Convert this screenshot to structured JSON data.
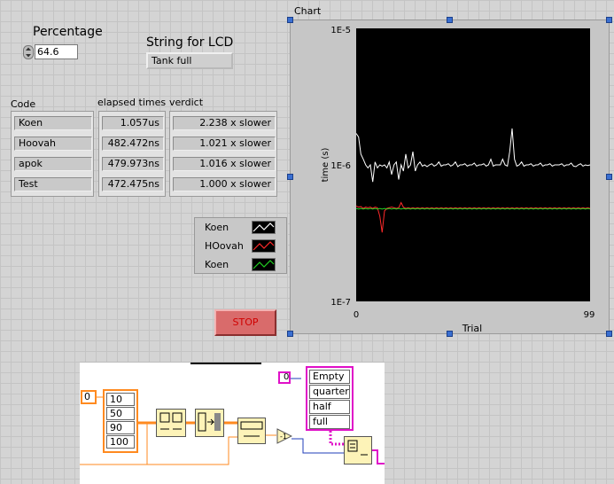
{
  "percentage": {
    "label": "Percentage",
    "value": "64.6"
  },
  "lcd": {
    "label": "String for LCD",
    "value": "Tank full"
  },
  "table": {
    "headers": {
      "code": "Code",
      "elapsed": "elapsed times",
      "verdict": "verdict"
    },
    "rows": [
      {
        "code": "Koen",
        "elapsed": "1.057us",
        "verdict": "2.238 x slower"
      },
      {
        "code": "Hoovah",
        "elapsed": "482.472ns",
        "verdict": "1.021 x slower"
      },
      {
        "code": "apok",
        "elapsed": "479.973ns",
        "verdict": "1.016 x slower"
      },
      {
        "code": "Test",
        "elapsed": "472.475ns",
        "verdict": "1.000 x slower"
      }
    ]
  },
  "legend": [
    {
      "name": "Koen",
      "color": "#ffffff"
    },
    {
      "name": "HOovah",
      "color": "#ff2a2a"
    },
    {
      "name": "Koen",
      "color": "#22d022"
    }
  ],
  "stop": {
    "label": "STOP"
  },
  "chart": {
    "label": "Chart"
  },
  "chart_data": {
    "type": "line",
    "xlabel": "Trial",
    "ylabel": "time (s)",
    "xlim": [
      0,
      99
    ],
    "ylim": [
      1e-07,
      1e-05
    ],
    "yscale": "log",
    "x_ticks": [
      "0",
      "99"
    ],
    "y_ticks": [
      "1E-5",
      "1E-6",
      "1E-7"
    ],
    "background": "#000000",
    "series": [
      {
        "color": "#ffffff",
        "values": [
          1.7e-06,
          1.6e-06,
          1.2e-06,
          1.1e-06,
          1e-06,
          9.5e-07,
          1e-06,
          7.5e-07,
          1.05e-06,
          9.5e-07,
          1e-06,
          9.8e-07,
          1e-06,
          9.5e-07,
          1.05e-06,
          8.5e-07,
          1e-06,
          1.05e-06,
          7.8e-07,
          1e-06,
          9e-07,
          1.2e-06,
          9.5e-07,
          1e-06,
          1.25e-06,
          9e-07,
          1e-06,
          1.05e-06,
          9.8e-07,
          1e-06,
          9.7e-07,
          1e-06,
          1.02e-06,
          9.8e-07,
          1e-06,
          1.05e-06,
          9.8e-07,
          1e-06,
          1e-06,
          1.02e-06,
          9.8e-07,
          1e-06,
          1.05e-06,
          9.7e-07,
          1e-06,
          1e-06,
          1.02e-06,
          9.8e-07,
          1e-06,
          1e-06,
          1.03e-06,
          9.8e-07,
          1e-06,
          1e-06,
          1.02e-06,
          9.8e-07,
          1e-06,
          1.1e-06,
          9.8e-07,
          1e-06,
          1e-06,
          1e-06,
          1.1e-06,
          1e-06,
          9.8e-07,
          1.25e-06,
          1.85e-06,
          1.1e-06,
          9.8e-07,
          1e-06,
          1.05e-06,
          9.8e-07,
          1e-06,
          1e-06,
          1.02e-06,
          9.8e-07,
          1e-06,
          1e-06,
          1.03e-06,
          9.8e-07,
          1e-06,
          1e-06,
          1.02e-06,
          9.8e-07,
          1e-06,
          1e-06,
          1e-06,
          1.02e-06,
          9.8e-07,
          1e-06,
          1e-06,
          1.03e-06,
          9.8e-07,
          9.7e-07,
          1e-06,
          1.02e-06,
          9.8e-07,
          1e-06,
          9.9e-07,
          1e-06
        ]
      },
      {
        "color": "#ff2a2a",
        "values": [
          5e-07,
          4.9e-07,
          4.95e-07,
          4.8e-07,
          4.9e-07,
          4.85e-07,
          4.9e-07,
          4.8e-07,
          4.9e-07,
          4.85e-07,
          4.2e-07,
          3.2e-07,
          4.6e-07,
          4.8e-07,
          4.85e-07,
          4.9e-07,
          4.85e-07,
          4.8e-07,
          4.85e-07,
          5.3e-07,
          4.9e-07,
          4.8e-07,
          4.85e-07,
          4.8e-07,
          4.85e-07,
          4.8e-07,
          4.85e-07,
          4.8e-07,
          4.85e-07,
          4.8e-07,
          4.85e-07,
          4.8e-07,
          4.85e-07,
          4.8e-07,
          4.85e-07,
          4.8e-07,
          4.85e-07,
          4.8e-07,
          4.85e-07,
          4.8e-07,
          4.85e-07,
          4.8e-07,
          4.85e-07,
          4.8e-07,
          4.85e-07,
          4.8e-07,
          4.85e-07,
          4.8e-07,
          4.85e-07,
          4.8e-07,
          4.85e-07,
          4.8e-07,
          4.85e-07,
          4.8e-07,
          4.85e-07,
          4.8e-07,
          4.85e-07,
          4.8e-07,
          4.85e-07,
          4.8e-07,
          4.85e-07,
          4.8e-07,
          4.85e-07,
          4.8e-07,
          4.85e-07,
          4.8e-07,
          4.85e-07,
          4.8e-07,
          4.85e-07,
          4.8e-07,
          4.85e-07,
          4.8e-07,
          4.85e-07,
          4.8e-07,
          4.85e-07,
          4.8e-07,
          4.85e-07,
          4.8e-07,
          4.85e-07,
          4.8e-07,
          4.85e-07,
          4.8e-07,
          4.85e-07,
          4.8e-07,
          4.85e-07,
          4.8e-07,
          4.85e-07,
          4.8e-07,
          4.85e-07,
          4.8e-07,
          4.85e-07,
          4.8e-07,
          4.85e-07,
          4.8e-07,
          4.85e-07,
          4.8e-07,
          4.85e-07,
          4.8e-07,
          4.85e-07,
          4.8e-07
        ]
      },
      {
        "color": "#22d022",
        "values": [
          4.8e-07,
          4.75e-07,
          4.8e-07,
          4.75e-07,
          4.8e-07,
          4.75e-07,
          4.8e-07,
          4.75e-07,
          4.8e-07,
          4.75e-07,
          4.8e-07,
          4.75e-07,
          4.8e-07,
          4.75e-07,
          4.8e-07,
          4.75e-07,
          4.8e-07,
          4.75e-07,
          4.8e-07,
          4.75e-07,
          4.8e-07,
          4.75e-07,
          4.8e-07,
          4.75e-07,
          4.8e-07,
          4.75e-07,
          4.8e-07,
          4.75e-07,
          4.8e-07,
          4.75e-07,
          4.8e-07,
          4.75e-07,
          4.8e-07,
          4.75e-07,
          4.8e-07,
          4.75e-07,
          4.8e-07,
          4.75e-07,
          4.8e-07,
          4.75e-07,
          4.8e-07,
          4.75e-07,
          4.8e-07,
          4.75e-07,
          4.8e-07,
          4.75e-07,
          4.8e-07,
          4.75e-07,
          4.8e-07,
          4.75e-07,
          4.8e-07,
          4.75e-07,
          4.8e-07,
          4.75e-07,
          4.8e-07,
          4.75e-07,
          4.8e-07,
          4.75e-07,
          4.8e-07,
          4.75e-07,
          4.8e-07,
          4.75e-07,
          4.8e-07,
          4.75e-07,
          4.8e-07,
          4.75e-07,
          4.8e-07,
          4.75e-07,
          4.8e-07,
          4.75e-07,
          4.8e-07,
          4.75e-07,
          4.8e-07,
          4.75e-07,
          4.8e-07,
          4.75e-07,
          4.8e-07,
          4.75e-07,
          4.8e-07,
          4.75e-07,
          4.8e-07,
          4.75e-07,
          4.8e-07,
          4.75e-07,
          4.8e-07,
          4.75e-07,
          4.8e-07,
          4.75e-07,
          4.8e-07,
          4.75e-07,
          4.8e-07,
          4.75e-07,
          4.8e-07,
          4.75e-07,
          4.8e-07,
          4.75e-07,
          4.8e-07,
          4.75e-07,
          4.8e-07,
          4.75e-07
        ]
      }
    ]
  },
  "block_diagram": {
    "const_a": "0",
    "array_values": [
      "10",
      "50",
      "90",
      "100"
    ],
    "const_b": "0",
    "string_array": [
      "Empty",
      "quarter",
      "half",
      "full"
    ],
    "wire_orange": "#ff8a1f",
    "wire_pink": "#e010c8",
    "wire_blue": "#1f3cb8"
  }
}
